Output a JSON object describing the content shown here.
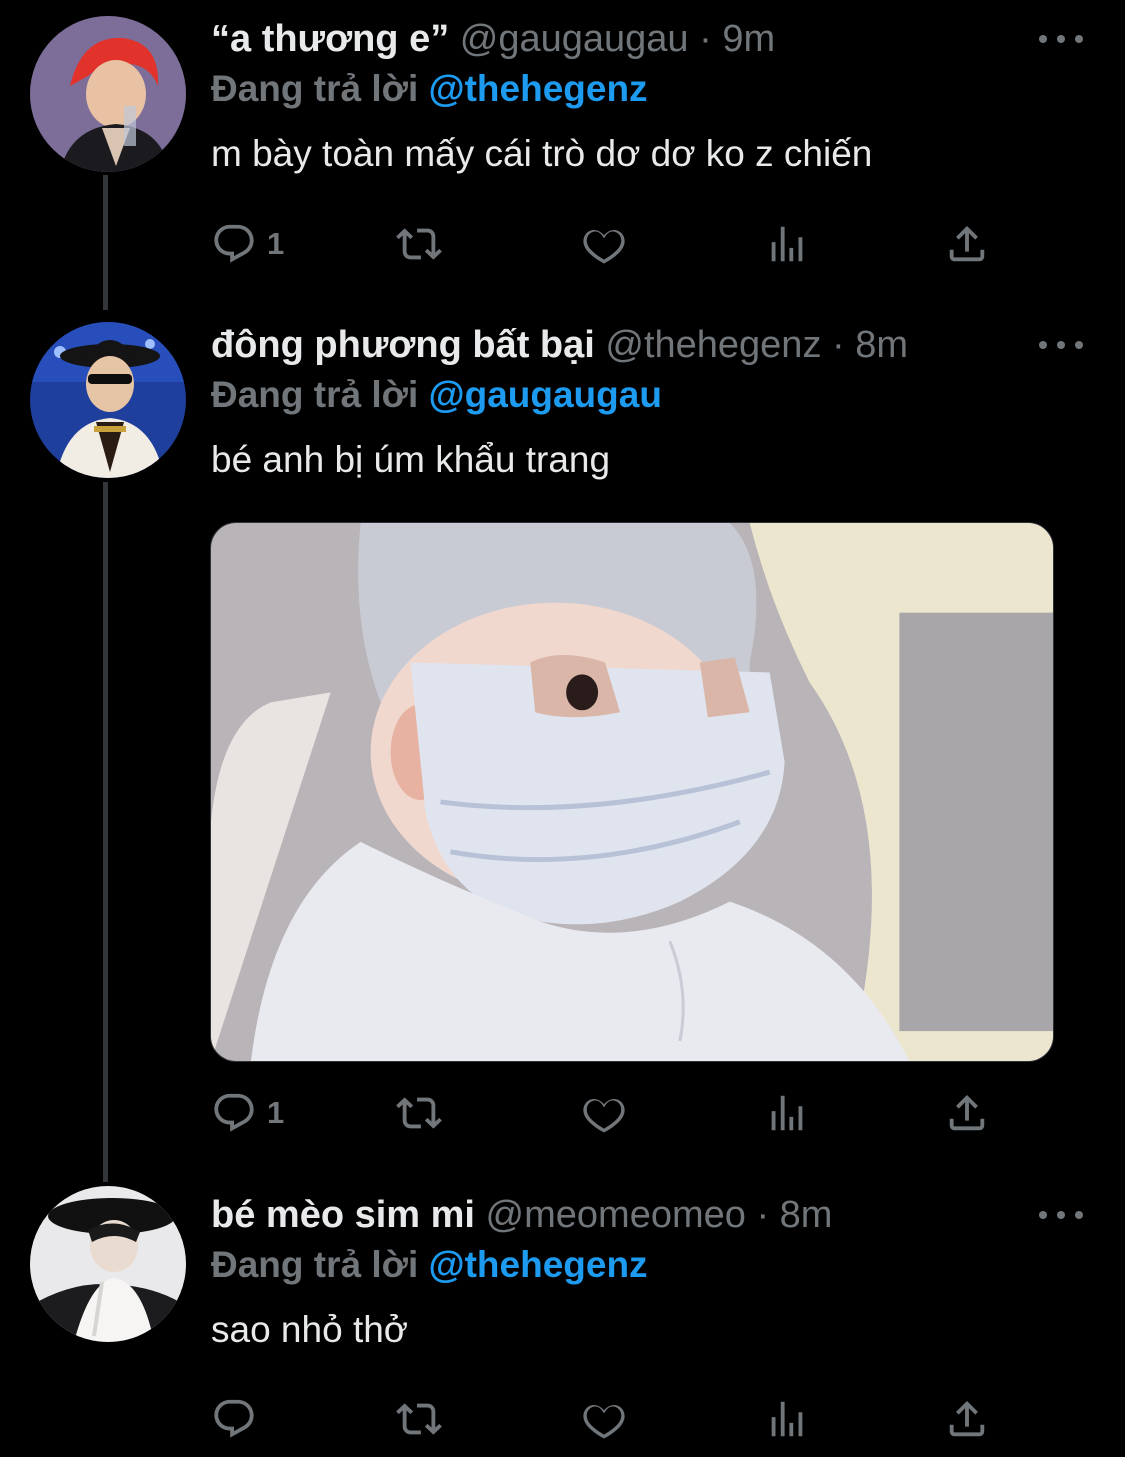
{
  "tweets": [
    {
      "display_name": "“a thương e”",
      "handle": "@gaugaugau",
      "separator": "·",
      "time": "9m",
      "reply_label": "Đang trả lời",
      "reply_mention": "@thehegenz",
      "text": "m bày toàn mấy cái trò dơ dơ ko z chiến",
      "reply_count": "1",
      "avatar": "avatar-red-hair-performer",
      "has_media": false
    },
    {
      "display_name": "đông phương bất bại",
      "handle": "@thehegenz",
      "separator": "·",
      "time": "8m",
      "reply_label": "Đang trả lời",
      "reply_mention": "@gaugaugau",
      "text": "bé anh bị úm khẩu trang",
      "reply_count": "1",
      "avatar": "avatar-hat-sunglasses-performer",
      "has_media": true,
      "media": "photo-baby-with-face-mask"
    },
    {
      "display_name": "bé mèo sim mi",
      "handle": "@meomeomeo",
      "separator": "·",
      "time": "8m",
      "reply_label": "Đang trả lời",
      "reply_mention": "@thehegenz",
      "text": "sao nhỏ thở",
      "reply_count": "",
      "avatar": "avatar-black-hat-white-shirt",
      "has_media": false
    }
  ],
  "icons": [
    "more-icon",
    "reply-icon",
    "retweet-icon",
    "like-icon",
    "views-icon",
    "share-icon"
  ],
  "colors": {
    "background": "#000000",
    "text": "#e7e9ea",
    "secondary": "#71767b",
    "link": "#1d9bf0",
    "thread_line": "#333639"
  }
}
